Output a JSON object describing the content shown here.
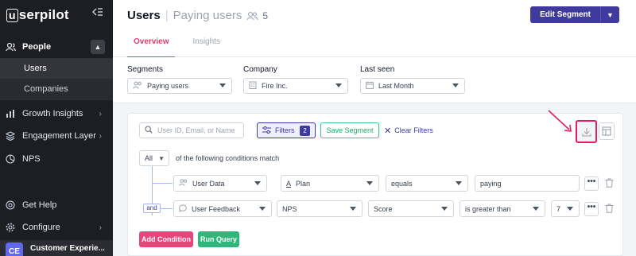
{
  "app": {
    "logo_prefix": "u",
    "logo_rest": "serpilot"
  },
  "sidebar": {
    "people_label": "People",
    "sub_items": [
      "Users",
      "Companies"
    ],
    "items": [
      {
        "label": "Growth Insights",
        "icon": "growth-icon"
      },
      {
        "label": "Engagement Layer",
        "icon": "layers-icon"
      },
      {
        "label": "NPS",
        "icon": "nps-icon"
      }
    ],
    "bottom_items": [
      {
        "label": "Get Help",
        "icon": "help-icon"
      },
      {
        "label": "Configure",
        "icon": "gear-icon"
      }
    ],
    "account": {
      "initials": "CE",
      "name": "Customer Experie..."
    }
  },
  "header": {
    "title": "Users",
    "subtitle": "Paying users",
    "segment_count": "5",
    "edit_segment_label": "Edit Segment",
    "tabs": [
      {
        "label": "Overview",
        "active": true
      },
      {
        "label": "Insights",
        "active": false
      }
    ]
  },
  "segment_bar": {
    "segments": {
      "label": "Segments",
      "value": "Paying users"
    },
    "company": {
      "label": "Company",
      "value": "Fire Inc."
    },
    "last_seen": {
      "label": "Last seen",
      "value": "Last Month"
    }
  },
  "filters": {
    "search_placeholder": "User ID, Email, or Name",
    "filters_label": "Filters",
    "filters_count": "2",
    "save_segment_label": "Save Segment",
    "clear_filters_label": "Clear Filters",
    "match_mode": "All",
    "match_text": "of the following conditions match",
    "and_label": "and",
    "rows": [
      {
        "source": "User Data",
        "attribute": "Plan",
        "operator": "equals",
        "value": "paying"
      },
      {
        "source": "User Feedback",
        "attribute": "NPS",
        "operator": "Score",
        "comparison": "is greater than",
        "value": "7"
      }
    ],
    "more_label": "•••",
    "add_condition_label": "Add Condition",
    "run_query_label": "Run Query"
  },
  "colors": {
    "accent": "#3f3a9e",
    "pink": "#e23b6d",
    "green": "#2fb779",
    "highlight": "#e11d66"
  }
}
